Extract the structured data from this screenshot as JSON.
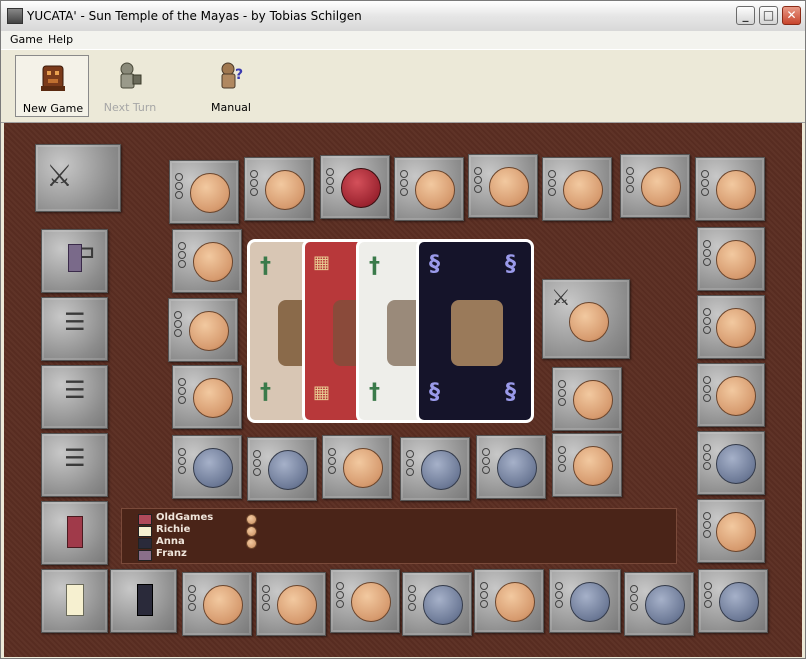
{
  "window": {
    "title": "YUCATA' - Sun Temple of the Mayas - by Tobias Schilgen"
  },
  "menu": [
    {
      "label": "Game"
    },
    {
      "label": "Help"
    }
  ],
  "toolbar": {
    "new_game": "New Game",
    "next_turn": "Next Turn",
    "manual": "Manual"
  },
  "players": [
    {
      "name": "OldGames",
      "color": "#b04a5a",
      "coin": true
    },
    {
      "name": "Richie",
      "color": "#f6f0d0",
      "coin": true
    },
    {
      "name": "Anna",
      "color": "#2a2a3a",
      "coin": true
    },
    {
      "name": "Franz",
      "color": "#8a6f8a",
      "coin": false
    }
  ],
  "colors": {
    "board": "#5b2e22",
    "coin_tan": "#d69a6e",
    "coin_blue": "#6c7996",
    "coin_red": "#9c2430"
  },
  "cards": [
    {
      "name": "tan-card",
      "symbol_icon": "dagger-icon",
      "bg": "#d8c6b4",
      "fg": "#3a7a4a"
    },
    {
      "name": "red-card",
      "symbol_icon": "grid-icon",
      "bg": "#b8383a",
      "fg": "#e8c890"
    },
    {
      "name": "white-card",
      "symbol_icon": "dagger-icon",
      "bg": "#eeeeea",
      "fg": "#3a7a4a"
    },
    {
      "name": "black-card",
      "symbol_icon": "spiral-icon",
      "bg": "#15142a",
      "fg": "#9a9aea"
    }
  ]
}
